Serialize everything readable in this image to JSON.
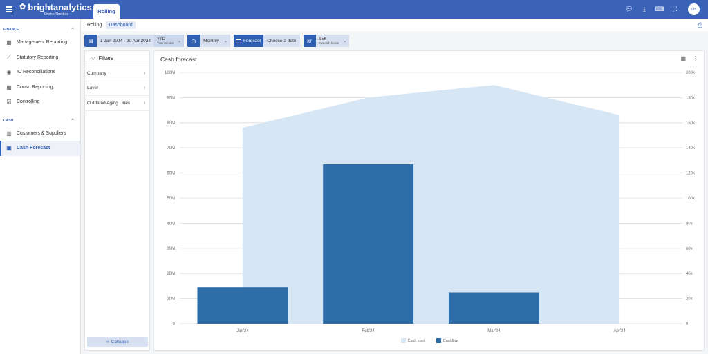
{
  "app": {
    "brand": "brightanalytics",
    "subtitle": "Demo Nordics",
    "active_tab": "Rolling",
    "avatar_initials": "LH",
    "accent": "#3a63b8"
  },
  "sidebar": {
    "sections": [
      {
        "title": "FINANCE",
        "items": [
          {
            "label": "Management Reporting",
            "icon": "grid-icon"
          },
          {
            "label": "Statutory Reporting",
            "icon": "trend-line-icon"
          },
          {
            "label": "IC Reconciliations",
            "icon": "globe-icon"
          },
          {
            "label": "Conso Reporting",
            "icon": "grid-icon"
          },
          {
            "label": "Controlling",
            "icon": "clipboard-check-icon"
          }
        ]
      },
      {
        "title": "CASH",
        "items": [
          {
            "label": "Customers & Suppliers",
            "icon": "building-icon"
          },
          {
            "label": "Cash Forecast",
            "icon": "wallet-icon",
            "active": true
          }
        ]
      }
    ]
  },
  "breadcrumbs": {
    "items": [
      "Rolling",
      "Dashboard"
    ],
    "active": "Dashboard"
  },
  "controls": {
    "date_range": "1 Jan 2024 - 30 Apr 2024",
    "period_type": "YTD",
    "period_type_sub": "Year to date",
    "interval": "Monthly",
    "forecast_label": "Forecast",
    "forecast_placeholder": "Choose a date",
    "currency_symbol": "kr",
    "currency_code": "SEK",
    "currency_name": "Swedish krona"
  },
  "filters": {
    "title": "Filters",
    "items": [
      "Company",
      "Layer",
      "Outdated Aging Lines"
    ],
    "collapse_label": "Collapse"
  },
  "chart": {
    "title": "Cash forecast"
  },
  "chart_data": {
    "type": "bar",
    "categories": [
      "Jan'24",
      "Feb'24",
      "Mar'24",
      "Apr'24"
    ],
    "series": [
      {
        "name": "Cashflow",
        "type": "bar",
        "axis": "left",
        "values": [
          14.5,
          63.5,
          12.5,
          null
        ],
        "color": "#2f6da8"
      },
      {
        "name": "Cash start",
        "type": "area",
        "axis": "right",
        "values": [
          156,
          180,
          190,
          166
        ],
        "color": "#d6e6f4"
      }
    ],
    "left_axis": {
      "ticks": [
        "0",
        "10M",
        "20M",
        "30M",
        "40M",
        "50M",
        "60M",
        "70M",
        "80M",
        "90M",
        "100M"
      ],
      "ylim": [
        0,
        100
      ],
      "unit": "M"
    },
    "right_axis": {
      "ticks": [
        "0",
        "20k",
        "40k",
        "60k",
        "80k",
        "100k",
        "120k",
        "140k",
        "160k",
        "180k",
        "200k"
      ],
      "ylim": [
        0,
        200
      ],
      "unit": "k"
    },
    "grid": true,
    "legend": "bottom-center"
  }
}
